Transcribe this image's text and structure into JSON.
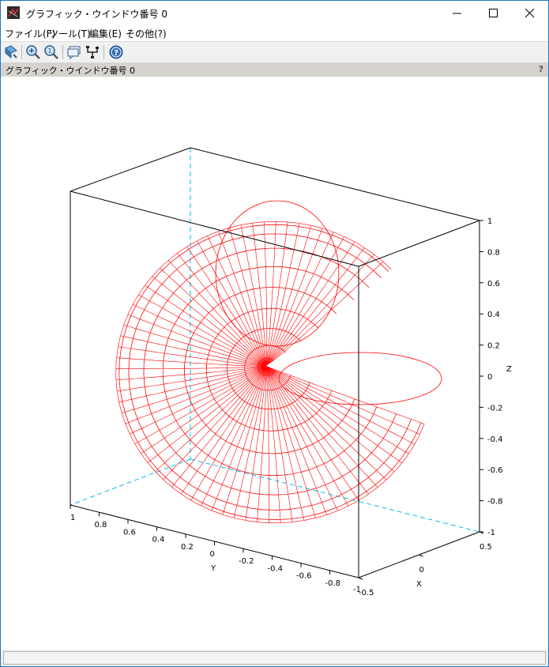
{
  "window": {
    "title": "グラフィック・ウインドウ番号 0"
  },
  "menubar": {
    "items": [
      "ファイル(F)",
      "ツール(T)",
      "編集(E)",
      "その他(?)"
    ]
  },
  "toolbar": {
    "buttons": [
      "rotate-icon",
      "zoom-icon",
      "unzoom-icon",
      "datatip-icon",
      "edit-axes-icon",
      "help-icon"
    ]
  },
  "infobar": {
    "text": "グラフィック・ウインドウ番号 0",
    "help": "?"
  },
  "statusbar": {
    "text": ""
  },
  "chart_data": {
    "type": "surface3d",
    "surface": "parametric surface (toroidal/spherical) drawn as mesh",
    "color": "#ff0000",
    "box_color": "#000000",
    "hidden_axes_color": "#00c0e0",
    "z_axis": {
      "label": "Z",
      "ticks": [
        "1",
        "0.8",
        "0.6",
        "0.4",
        "0.2",
        "0",
        "-0.2",
        "-0.4",
        "-0.6",
        "-0.8",
        "-1"
      ],
      "range": [
        -1,
        1
      ]
    },
    "y_axis": {
      "label": "Y",
      "ticks": [
        "1",
        "0.8",
        "0.6",
        "0.4",
        "0.2",
        "0",
        "-0.2",
        "-0.4",
        "-0.6",
        "-0.8"
      ],
      "range": [
        -1,
        1
      ]
    },
    "x_axis": {
      "label": "X",
      "ticks": [
        "0.5",
        "0",
        "-0.5"
      ],
      "range": [
        -0.5,
        0.5
      ]
    },
    "corner_label": "-1"
  }
}
